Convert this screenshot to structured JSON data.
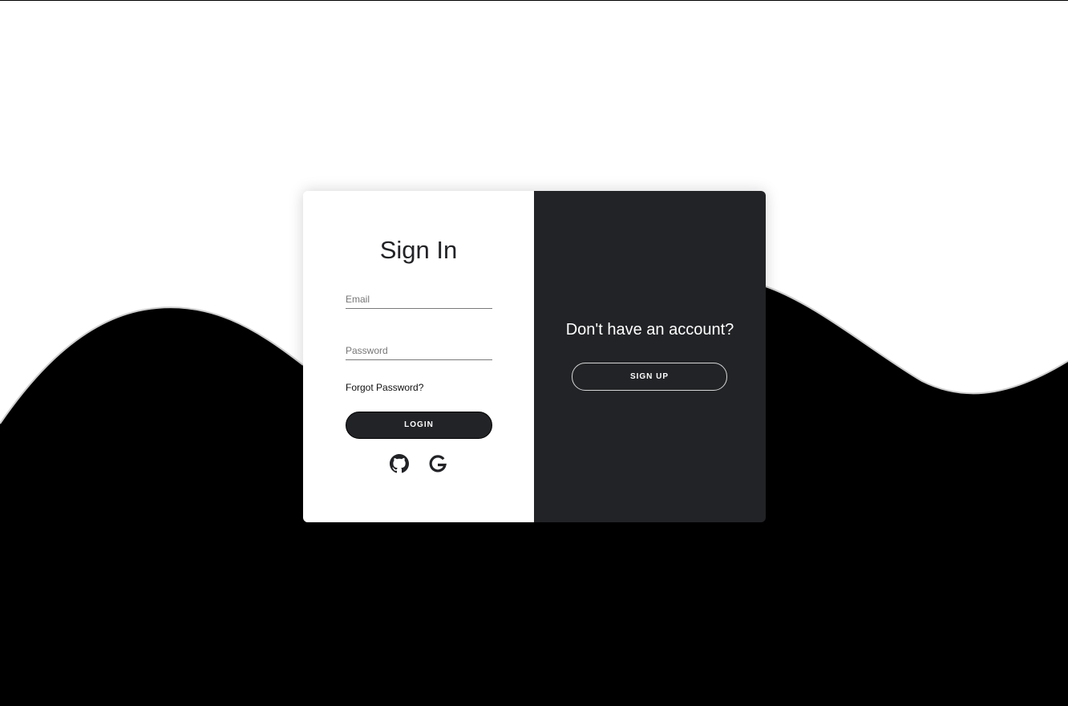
{
  "signin": {
    "title": "Sign In",
    "email_placeholder": "Email",
    "password_placeholder": "Password",
    "forgot_label": "Forgot Password?",
    "login_label": "LOGIN",
    "social_icons": [
      "github-icon",
      "google-icon"
    ]
  },
  "signup_panel": {
    "prompt": "Don't have an account?",
    "signup_label": "SIGN UP"
  },
  "colors": {
    "dark": "#222326",
    "background": "#ffffff",
    "wave": "#000000"
  }
}
